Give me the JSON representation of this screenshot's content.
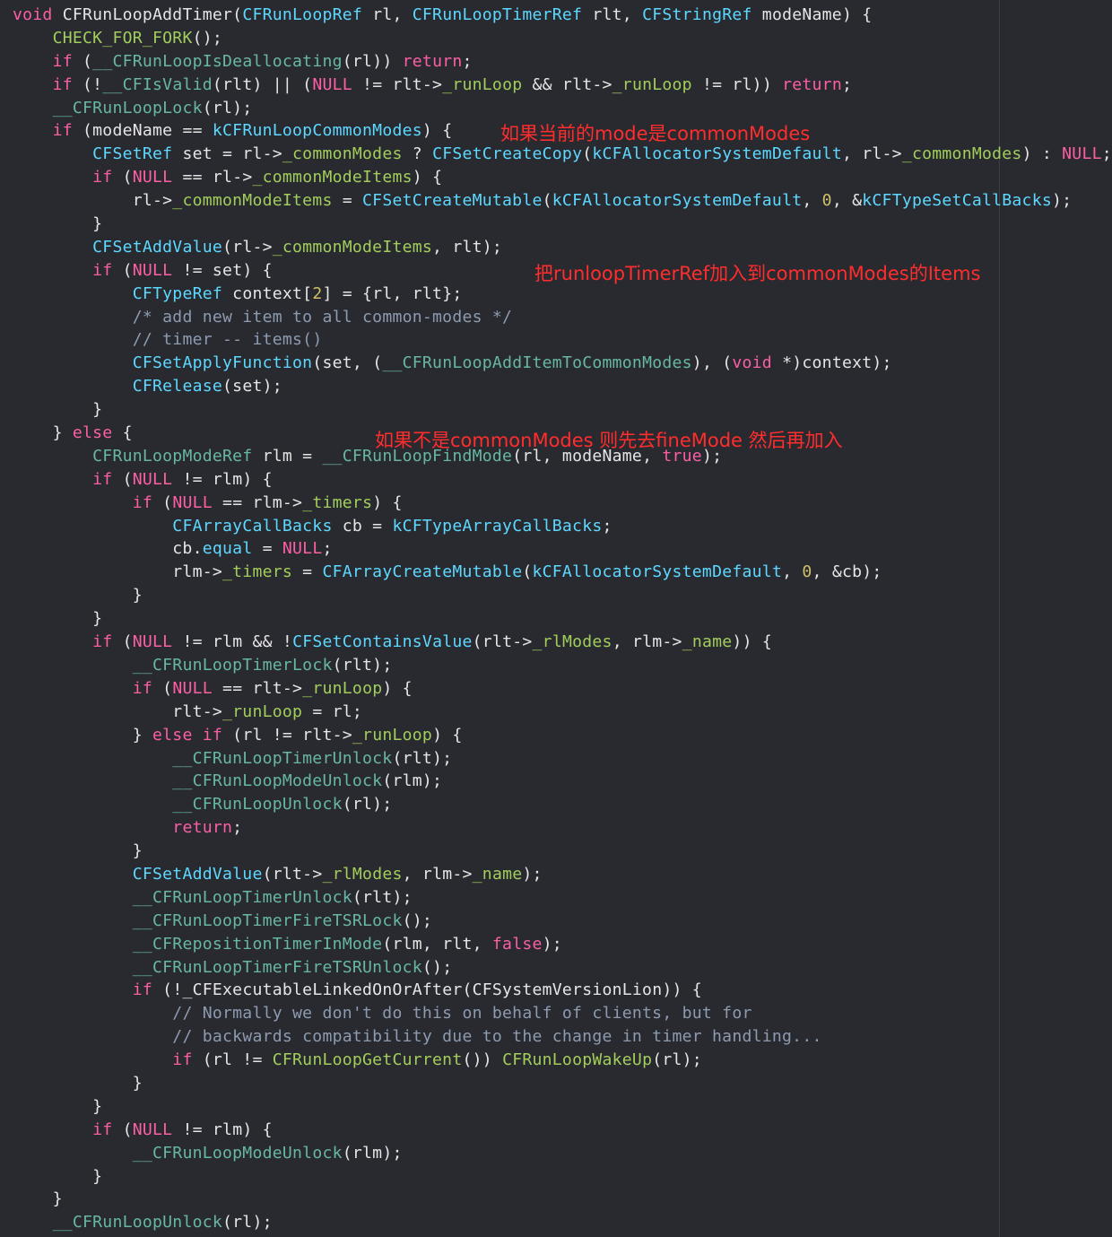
{
  "theme": {
    "background": "#292a30",
    "colors": {
      "keyword": "#fc5fa3",
      "type": "#5dd8ff",
      "function": "#67b7a4",
      "macro": "#a2ce5b",
      "member": "#a2ce5b",
      "number": "#d0bf69",
      "comment": "#8d9bb0",
      "plain": "#e6e6e6",
      "annotation": "#ff2d2d"
    }
  },
  "annotations": [
    {
      "id": "common-modes",
      "text": "如果当前的mode是commonModes"
    },
    {
      "id": "add-to-items",
      "text": "把runloopTimerRef加入到commonModes的Items"
    },
    {
      "id": "find-mode",
      "text": "如果不是commonModes 则先去fineMode  然后再加入"
    }
  ],
  "code_lines": [
    [
      [
        "kw",
        "void"
      ],
      [
        "pl",
        " CFRunLoopAddTimer("
      ],
      [
        "ty",
        "CFRunLoopRef"
      ],
      [
        "pl",
        " rl, "
      ],
      [
        "ty",
        "CFRunLoopTimerRef"
      ],
      [
        "pl",
        " rlt, "
      ],
      [
        "ty",
        "CFStringRef"
      ],
      [
        "pl",
        " modeName) {"
      ]
    ],
    [
      [
        "pl",
        "    "
      ],
      [
        "mac",
        "CHECK_FOR_FORK"
      ],
      [
        "pl",
        "();"
      ]
    ],
    [
      [
        "pl",
        "    "
      ],
      [
        "kw",
        "if"
      ],
      [
        "pl",
        " ("
      ],
      [
        "fn",
        "__CFRunLoopIsDeallocating"
      ],
      [
        "pl",
        "(rl)) "
      ],
      [
        "kw",
        "return"
      ],
      [
        "pl",
        ";"
      ]
    ],
    [
      [
        "pl",
        "    "
      ],
      [
        "kw",
        "if"
      ],
      [
        "pl",
        " (!"
      ],
      [
        "fn",
        "__CFIsValid"
      ],
      [
        "pl",
        "(rlt) || ("
      ],
      [
        "kw",
        "NULL"
      ],
      [
        "pl",
        " != rlt->"
      ],
      [
        "fld",
        "_runLoop"
      ],
      [
        "pl",
        " && rlt->"
      ],
      [
        "fld",
        "_runLoop"
      ],
      [
        "pl",
        " != rl)) "
      ],
      [
        "kw",
        "return"
      ],
      [
        "pl",
        ";"
      ]
    ],
    [
      [
        "pl",
        "    "
      ],
      [
        "fn",
        "__CFRunLoopLock"
      ],
      [
        "pl",
        "(rl);"
      ]
    ],
    [
      [
        "pl",
        "    "
      ],
      [
        "kw",
        "if"
      ],
      [
        "pl",
        " (modeName == "
      ],
      [
        "ty",
        "kCFRunLoopCommonModes"
      ],
      [
        "pl",
        ") {"
      ]
    ],
    [
      [
        "pl",
        "        "
      ],
      [
        "ty",
        "CFSetRef"
      ],
      [
        "pl",
        " set = rl->"
      ],
      [
        "fld",
        "_commonModes"
      ],
      [
        "pl",
        " ? "
      ],
      [
        "ty",
        "CFSetCreateCopy"
      ],
      [
        "pl",
        "("
      ],
      [
        "ty",
        "kCFAllocatorSystemDefault"
      ],
      [
        "pl",
        ", rl->"
      ],
      [
        "fld",
        "_commonModes"
      ],
      [
        "pl",
        ") : "
      ],
      [
        "kw",
        "NULL"
      ],
      [
        "pl",
        ";"
      ]
    ],
    [
      [
        "pl",
        "        "
      ],
      [
        "kw",
        "if"
      ],
      [
        "pl",
        " ("
      ],
      [
        "kw",
        "NULL"
      ],
      [
        "pl",
        " == rl->"
      ],
      [
        "fld",
        "_commonModeItems"
      ],
      [
        "pl",
        ") {"
      ]
    ],
    [
      [
        "pl",
        "            rl->"
      ],
      [
        "fld",
        "_commonModeItems"
      ],
      [
        "pl",
        " = "
      ],
      [
        "ty",
        "CFSetCreateMutable"
      ],
      [
        "pl",
        "("
      ],
      [
        "ty",
        "kCFAllocatorSystemDefault"
      ],
      [
        "pl",
        ", "
      ],
      [
        "num",
        "0"
      ],
      [
        "pl",
        ", &"
      ],
      [
        "ty",
        "kCFTypeSetCallBacks"
      ],
      [
        "pl",
        ");"
      ]
    ],
    [
      [
        "pl",
        "        }"
      ]
    ],
    [
      [
        "pl",
        "        "
      ],
      [
        "ty",
        "CFSetAddValue"
      ],
      [
        "pl",
        "(rl->"
      ],
      [
        "fld",
        "_commonModeItems"
      ],
      [
        "pl",
        ", rlt);"
      ]
    ],
    [
      [
        "pl",
        "        "
      ],
      [
        "kw",
        "if"
      ],
      [
        "pl",
        " ("
      ],
      [
        "kw",
        "NULL"
      ],
      [
        "pl",
        " != set) {"
      ]
    ],
    [
      [
        "pl",
        "            "
      ],
      [
        "ty",
        "CFTypeRef"
      ],
      [
        "pl",
        " context["
      ],
      [
        "num",
        "2"
      ],
      [
        "pl",
        "] = {rl, rlt};"
      ]
    ],
    [
      [
        "pl",
        "            "
      ],
      [
        "cm",
        "/* add new item to all common-modes */"
      ]
    ],
    [
      [
        "pl",
        "            "
      ],
      [
        "cm",
        "// timer -- items()"
      ]
    ],
    [
      [
        "pl",
        "            "
      ],
      [
        "ty",
        "CFSetApplyFunction"
      ],
      [
        "pl",
        "(set, ("
      ],
      [
        "fn",
        "__CFRunLoopAddItemToCommonModes"
      ],
      [
        "pl",
        "), ("
      ],
      [
        "kw",
        "void"
      ],
      [
        "pl",
        " *)context);"
      ]
    ],
    [
      [
        "pl",
        "            "
      ],
      [
        "ty",
        "CFRelease"
      ],
      [
        "pl",
        "(set);"
      ]
    ],
    [
      [
        "pl",
        "        }"
      ]
    ],
    [
      [
        "pl",
        "    } "
      ],
      [
        "kw",
        "else"
      ],
      [
        "pl",
        " {"
      ]
    ],
    [
      [
        "pl",
        "        "
      ],
      [
        "fn",
        "CFRunLoopModeRef"
      ],
      [
        "pl",
        " rlm = "
      ],
      [
        "fn",
        "__CFRunLoopFindMode"
      ],
      [
        "pl",
        "(rl, modeName, "
      ],
      [
        "kw",
        "true"
      ],
      [
        "pl",
        ");"
      ]
    ],
    [
      [
        "pl",
        "        "
      ],
      [
        "kw",
        "if"
      ],
      [
        "pl",
        " ("
      ],
      [
        "kw",
        "NULL"
      ],
      [
        "pl",
        " != rlm) {"
      ]
    ],
    [
      [
        "pl",
        "            "
      ],
      [
        "kw",
        "if"
      ],
      [
        "pl",
        " ("
      ],
      [
        "kw",
        "NULL"
      ],
      [
        "pl",
        " == rlm->"
      ],
      [
        "fld",
        "_timers"
      ],
      [
        "pl",
        ") {"
      ]
    ],
    [
      [
        "pl",
        "                "
      ],
      [
        "ty",
        "CFArrayCallBacks"
      ],
      [
        "pl",
        " cb = "
      ],
      [
        "ty",
        "kCFTypeArrayCallBacks"
      ],
      [
        "pl",
        ";"
      ]
    ],
    [
      [
        "pl",
        "                cb."
      ],
      [
        "ty",
        "equal"
      ],
      [
        "pl",
        " = "
      ],
      [
        "kw",
        "NULL"
      ],
      [
        "pl",
        ";"
      ]
    ],
    [
      [
        "pl",
        "                rlm->"
      ],
      [
        "fld",
        "_timers"
      ],
      [
        "pl",
        " = "
      ],
      [
        "ty",
        "CFArrayCreateMutable"
      ],
      [
        "pl",
        "("
      ],
      [
        "ty",
        "kCFAllocatorSystemDefault"
      ],
      [
        "pl",
        ", "
      ],
      [
        "num",
        "0"
      ],
      [
        "pl",
        ", &cb);"
      ]
    ],
    [
      [
        "pl",
        "            }"
      ]
    ],
    [
      [
        "pl",
        "        }"
      ]
    ],
    [
      [
        "pl",
        "        "
      ],
      [
        "kw",
        "if"
      ],
      [
        "pl",
        " ("
      ],
      [
        "kw",
        "NULL"
      ],
      [
        "pl",
        " != rlm && !"
      ],
      [
        "ty",
        "CFSetContainsValue"
      ],
      [
        "pl",
        "(rlt->"
      ],
      [
        "fld",
        "_rlModes"
      ],
      [
        "pl",
        ", rlm->"
      ],
      [
        "fld",
        "_name"
      ],
      [
        "pl",
        ")) {"
      ]
    ],
    [
      [
        "pl",
        "            "
      ],
      [
        "fn",
        "__CFRunLoopTimerLock"
      ],
      [
        "pl",
        "(rlt);"
      ]
    ],
    [
      [
        "pl",
        "            "
      ],
      [
        "kw",
        "if"
      ],
      [
        "pl",
        " ("
      ],
      [
        "kw",
        "NULL"
      ],
      [
        "pl",
        " == rlt->"
      ],
      [
        "fld",
        "_runLoop"
      ],
      [
        "pl",
        ") {"
      ]
    ],
    [
      [
        "pl",
        "                rlt->"
      ],
      [
        "fld",
        "_runLoop"
      ],
      [
        "pl",
        " = rl;"
      ]
    ],
    [
      [
        "pl",
        "            } "
      ],
      [
        "kw",
        "else if"
      ],
      [
        "pl",
        " (rl != rlt->"
      ],
      [
        "fld",
        "_runLoop"
      ],
      [
        "pl",
        ") {"
      ]
    ],
    [
      [
        "pl",
        "                "
      ],
      [
        "fn",
        "__CFRunLoopTimerUnlock"
      ],
      [
        "pl",
        "(rlt);"
      ]
    ],
    [
      [
        "pl",
        "                "
      ],
      [
        "fn",
        "__CFRunLoopModeUnlock"
      ],
      [
        "pl",
        "(rlm);"
      ]
    ],
    [
      [
        "pl",
        "                "
      ],
      [
        "fn",
        "__CFRunLoopUnlock"
      ],
      [
        "pl",
        "(rl);"
      ]
    ],
    [
      [
        "pl",
        "                "
      ],
      [
        "kw",
        "return"
      ],
      [
        "pl",
        ";"
      ]
    ],
    [
      [
        "pl",
        "            }"
      ]
    ],
    [
      [
        "pl",
        "            "
      ],
      [
        "ty",
        "CFSetAddValue"
      ],
      [
        "pl",
        "(rlt->"
      ],
      [
        "fld",
        "_rlModes"
      ],
      [
        "pl",
        ", rlm->"
      ],
      [
        "fld",
        "_name"
      ],
      [
        "pl",
        ");"
      ]
    ],
    [
      [
        "pl",
        "            "
      ],
      [
        "fn",
        "__CFRunLoopTimerUnlock"
      ],
      [
        "pl",
        "(rlt);"
      ]
    ],
    [
      [
        "pl",
        "            "
      ],
      [
        "fn",
        "__CFRunLoopTimerFireTSRLock"
      ],
      [
        "pl",
        "();"
      ]
    ],
    [
      [
        "pl",
        "            "
      ],
      [
        "fn",
        "__CFRepositionTimerInMode"
      ],
      [
        "pl",
        "(rlm, rlt, "
      ],
      [
        "kw",
        "false"
      ],
      [
        "pl",
        ");"
      ]
    ],
    [
      [
        "pl",
        "            "
      ],
      [
        "fn",
        "__CFRunLoopTimerFireTSRUnlock"
      ],
      [
        "pl",
        "();"
      ]
    ],
    [
      [
        "pl",
        "            "
      ],
      [
        "kw",
        "if"
      ],
      [
        "pl",
        " (!_CFExecutableLinkedOnOrAfter(CFSystemVersionLion)) {"
      ]
    ],
    [
      [
        "pl",
        "                "
      ],
      [
        "cm",
        "// Normally we don't do this on behalf of clients, but for"
      ]
    ],
    [
      [
        "pl",
        "                "
      ],
      [
        "cm",
        "// backwards compatibility due to the change in timer handling..."
      ]
    ],
    [
      [
        "pl",
        "                "
      ],
      [
        "kw",
        "if"
      ],
      [
        "pl",
        " (rl != "
      ],
      [
        "mac",
        "CFRunLoopGetCurrent"
      ],
      [
        "pl",
        "()) "
      ],
      [
        "mac",
        "CFRunLoopWakeUp"
      ],
      [
        "pl",
        "(rl);"
      ]
    ],
    [
      [
        "pl",
        "            }"
      ]
    ],
    [
      [
        "pl",
        "        }"
      ]
    ],
    [
      [
        "pl",
        "        "
      ],
      [
        "kw",
        "if"
      ],
      [
        "pl",
        " ("
      ],
      [
        "kw",
        "NULL"
      ],
      [
        "pl",
        " != rlm) {"
      ]
    ],
    [
      [
        "pl",
        "            "
      ],
      [
        "fn",
        "__CFRunLoopModeUnlock"
      ],
      [
        "pl",
        "(rlm);"
      ]
    ],
    [
      [
        "pl",
        "        }"
      ]
    ],
    [
      [
        "pl",
        "    }"
      ]
    ],
    [
      [
        "pl",
        "    "
      ],
      [
        "fn",
        "__CFRunLoopUnlock"
      ],
      [
        "pl",
        "(rl);"
      ]
    ]
  ]
}
